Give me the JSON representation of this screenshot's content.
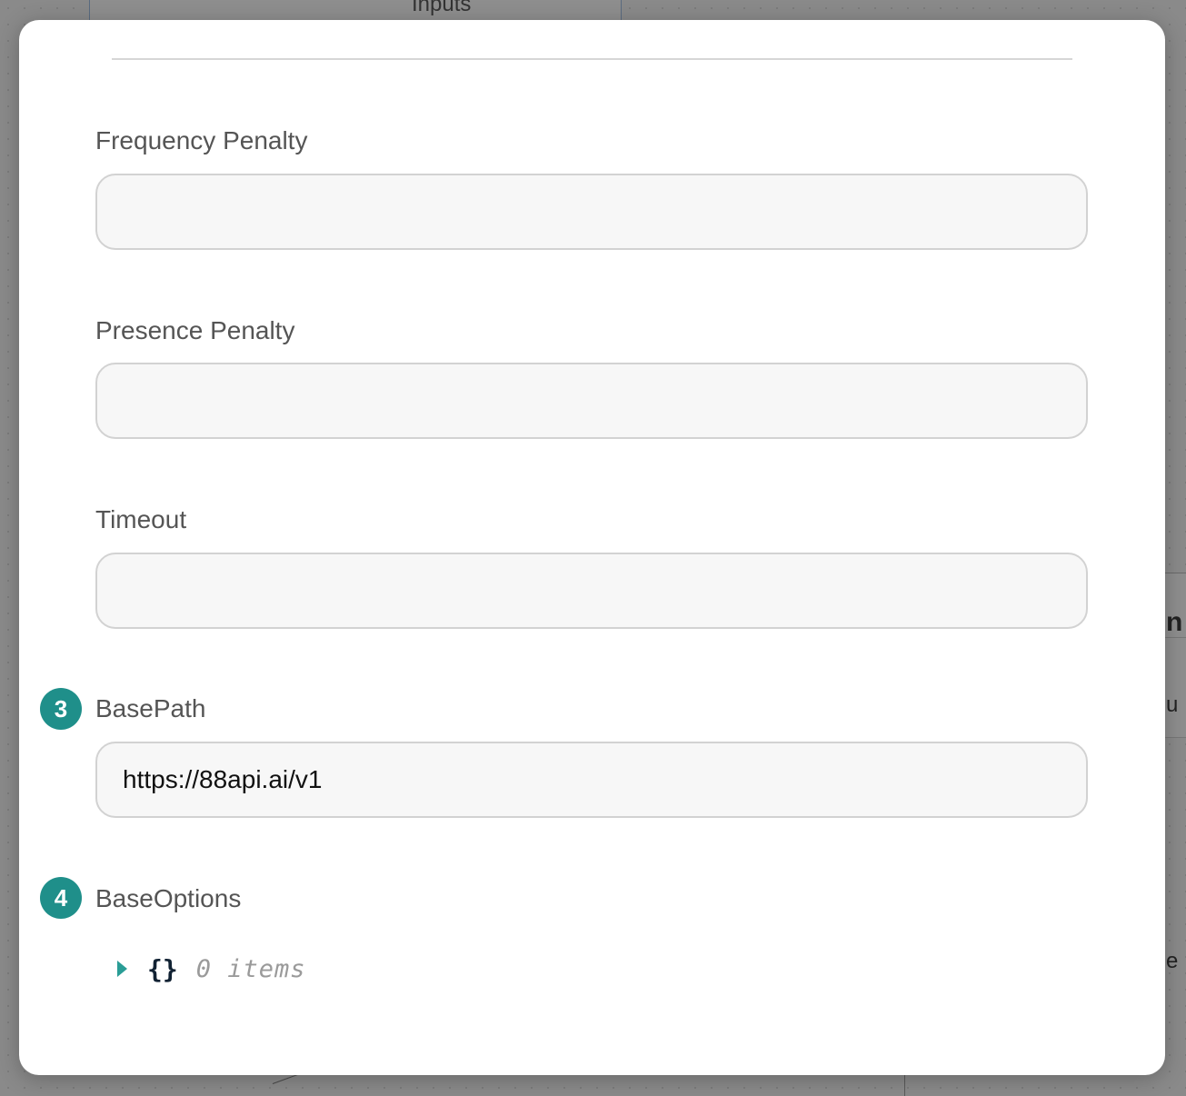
{
  "background": {
    "node_label": "Inputs",
    "right_fragments": [
      "n",
      "u",
      "e"
    ]
  },
  "form": {
    "fields": [
      {
        "label": "Frequency Penalty",
        "value": ""
      },
      {
        "label": "Presence Penalty",
        "value": ""
      },
      {
        "label": "Timeout",
        "value": ""
      },
      {
        "badge": "3",
        "label": "BasePath",
        "value": "https://88api.ai/v1"
      }
    ],
    "base_options": {
      "badge": "4",
      "label": "BaseOptions",
      "braces": "{}",
      "items_text": "0 items"
    }
  },
  "colors": {
    "badge": "#1f8f8a",
    "caret": "#2a9d96"
  },
  "icons": {
    "expand": "caret-right-icon"
  }
}
